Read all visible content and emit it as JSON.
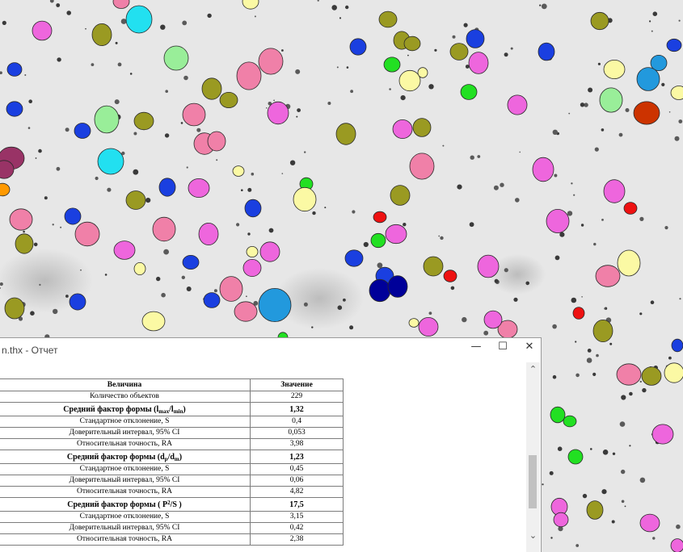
{
  "window": {
    "title": "n.thx - Отчет",
    "minimize_glyph": "—",
    "maximize_glyph": "☐",
    "close_glyph": "✕",
    "scroll_up_glyph": "⌃",
    "scroll_down_glyph": "⌄"
  },
  "report": {
    "headers": [
      "Величина",
      "Значение"
    ],
    "rows": [
      {
        "label": "Количество объектов",
        "value": "229"
      },
      {
        "label_main": "Средний фактор формы (l",
        "sub1": "max",
        "mid": "/l",
        "sub2": "min",
        "tail": ")",
        "value": "1,32"
      },
      {
        "label": "Стандартное отклонение, S",
        "value": "0,4"
      },
      {
        "label": "Доверительный интервал, 95% CI",
        "value": "0,053"
      },
      {
        "label": "Относительная точность, RA",
        "value": "3,98"
      },
      {
        "label_main": "Средний фактор формы (d",
        "sub1": "p",
        "mid": "/d",
        "sub2": "m",
        "tail": ")",
        "value": "1,23"
      },
      {
        "label": "Стандартное отклонение, S",
        "value": "0,45"
      },
      {
        "label": "Доверительный интервал, 95% CI",
        "value": "0,06"
      },
      {
        "label": "Относительная точность, RA",
        "value": "4,82"
      },
      {
        "label_main": "Средний фактор формы ( P",
        "sup": "2",
        "tail": "/S )",
        "value": "17,5"
      },
      {
        "label": "Стандартное отклонение, S",
        "value": "3,15"
      },
      {
        "label": "Доверительный интервал, 95% CI",
        "value": "0,42"
      },
      {
        "label": "Относительная точность, RA",
        "value": "2,38"
      }
    ]
  },
  "image": {
    "background": "#e6e6e6",
    "palette": {
      "pink": "#f080a8",
      "magenta": "#ee66dd",
      "olive": "#9a9a22",
      "blue": "#1a3fe0",
      "cyan": "#22e0f0",
      "yellow": "#fbf9a4",
      "green": "#22e022",
      "lightgreen": "#99ee99",
      "red": "#ee1111",
      "navy": "#000099",
      "skyblue": "#2299dd",
      "plum": "#993366",
      "orange": "#ff9900",
      "rust": "#cc3300"
    }
  }
}
